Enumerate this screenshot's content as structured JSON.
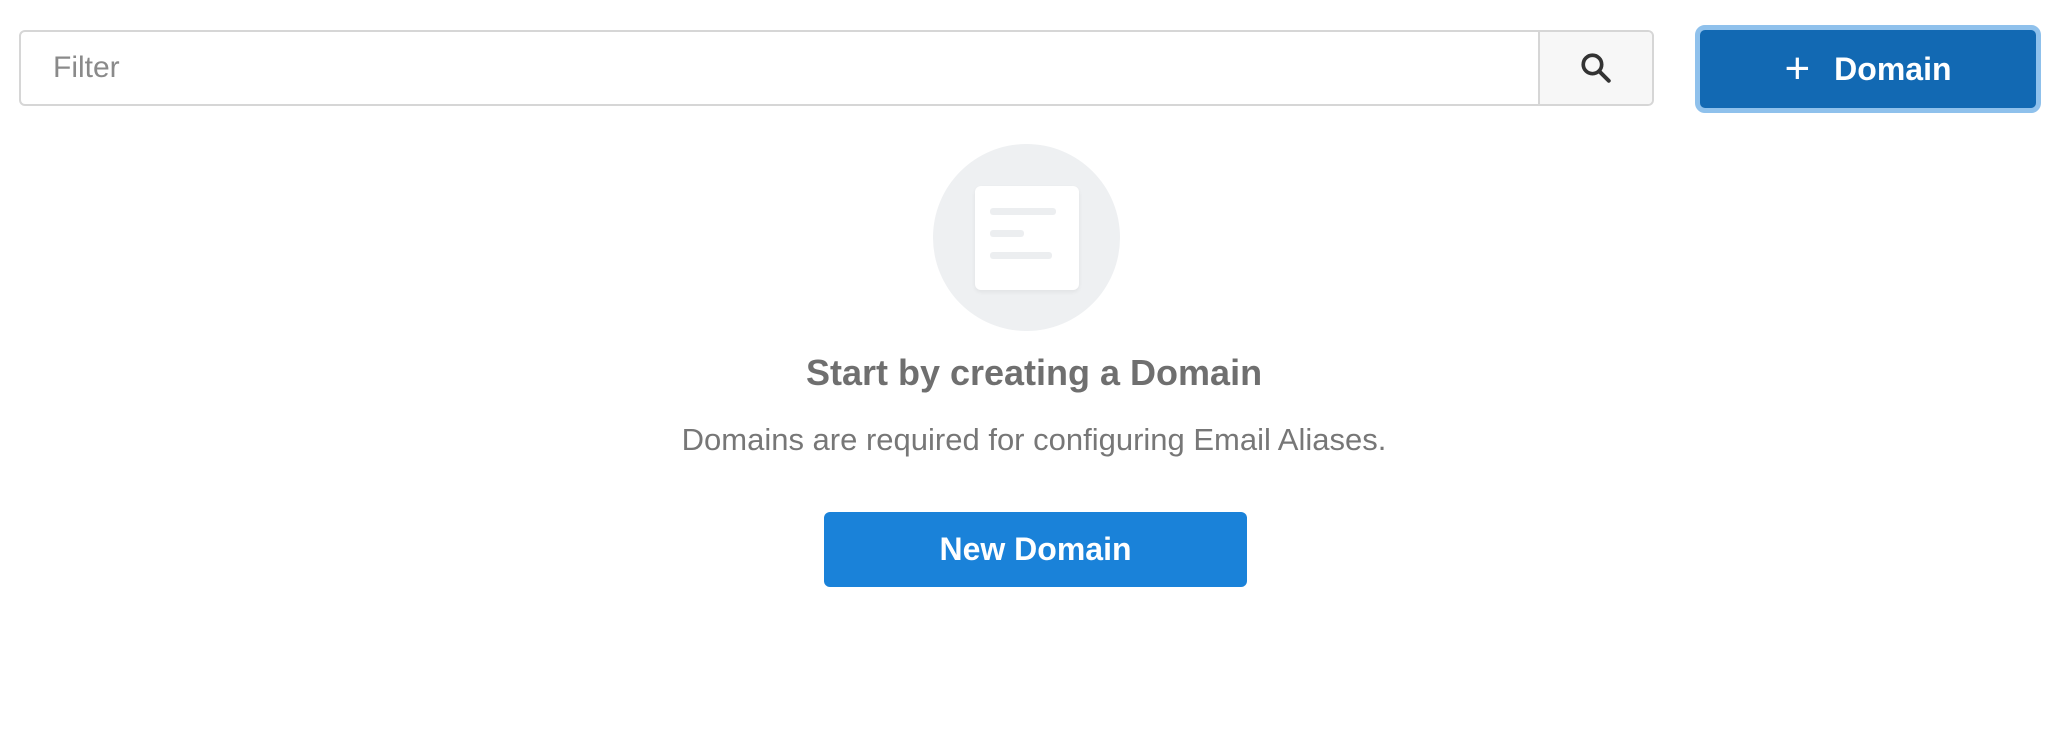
{
  "filter": {
    "placeholder": "Filter",
    "value": ""
  },
  "search_button": {
    "icon": "search-icon"
  },
  "header": {
    "add_button_icon": "+",
    "add_button_label": "Domain"
  },
  "empty_state": {
    "icon": "document-icon",
    "title": "Start by creating a Domain",
    "description": "Domains are required for configuring Email Aliases.",
    "cta_label": "New Domain"
  },
  "colors": {
    "primary_button": "#1269b3",
    "cta_button": "#1a82d9",
    "focus_ring": "#8fc1ec"
  }
}
